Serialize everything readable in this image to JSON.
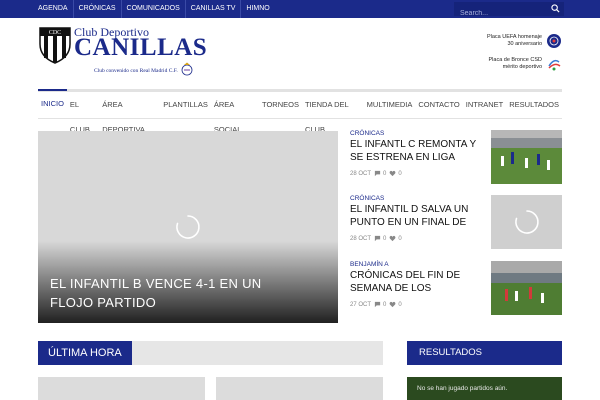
{
  "topbar": {
    "items": [
      "AGENDA",
      "CRÓNICAS",
      "COMUNICADOS",
      "CANILLAS TV",
      "HIMNO"
    ],
    "search_placeholder": "Search..."
  },
  "header": {
    "brand_top": "Club Deportivo",
    "brand_main": "CANILLAS",
    "brand_sub": "Club convenido con Real Madrid C.F.",
    "awards": [
      {
        "line1": "Placa UEFA homenaje",
        "line2": "30 aniversario"
      },
      {
        "line1": "Placa de Bronce CSD",
        "line2": "mérito deportivo"
      }
    ]
  },
  "nav": {
    "items": [
      "INICIO",
      "EL CLUB",
      "ÁREA DEPORTIVA",
      "PLANTILLAS",
      "ÁREA SOCIAL",
      "TORNEOS",
      "TIENDA DEL CLUB",
      "MULTIMEDIA",
      "CONTACTO",
      "INTRANET",
      "RESULTADOS"
    ],
    "active_index": 0
  },
  "featured": {
    "title": "EL INFANTIL B VENCE 4-1 EN UN FLOJO PARTIDO"
  },
  "articles": [
    {
      "category": "CRÓNICAS",
      "title": "EL INFANTL C REMONTA Y SE ESTRENA EN LIGA",
      "date": "28 OCT",
      "comments": "0",
      "likes": "0",
      "thumb": "image"
    },
    {
      "category": "CRÓNICAS",
      "title": "EL INFANTIL D SALVA UN PUNTO EN UN FINAL DE",
      "date": "28 OCT",
      "comments": "0",
      "likes": "0",
      "thumb": "loading"
    },
    {
      "category": "BENJAMÍN A",
      "title": "CRÓNICAS DEL FIN DE SEMANA DE LOS",
      "date": "27 OCT",
      "comments": "0",
      "likes": "0",
      "thumb": "image"
    }
  ],
  "sections": {
    "ultima_hora": "ÚLTIMA HORA",
    "resultados": "RESULTADOS",
    "resultados_empty": "No se han jugado partidos aún."
  },
  "colors": {
    "brand": "#1b2a8a",
    "topbar": "#1b2a8a"
  }
}
